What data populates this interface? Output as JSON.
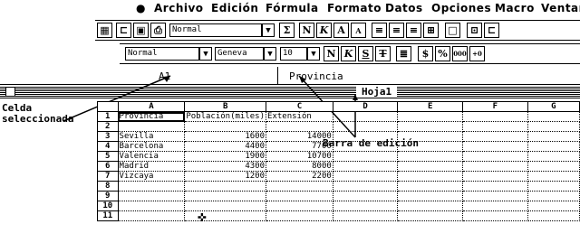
{
  "menu": {
    "apple": "",
    "items": [
      "Archivo",
      "Edición",
      "Fórmula",
      "Formato",
      "Datos",
      "Opciones",
      "Macro",
      "Ventana"
    ]
  },
  "toolbar1": {
    "style_value": "Normal",
    "sum_label": "Σ",
    "bold_label": "N",
    "italic_label": "K",
    "grow_font_label": "A",
    "shrink_font_label": "A"
  },
  "toolbar2": {
    "style_value": "Normal",
    "font_value": "Geneva",
    "size_value": "10",
    "bold_label": "N",
    "italic_label": "K",
    "underline_label": "S",
    "strike_label": "T",
    "percent_label": "%",
    "thousands_label": "000",
    "decimal_label": "+0"
  },
  "formula_bar": {
    "cell_ref": "A1",
    "content": "Provincia"
  },
  "window": {
    "title": "Hoja1"
  },
  "sheet": {
    "columns": [
      "A",
      "B",
      "C",
      "D",
      "E",
      "F",
      "G"
    ],
    "rows": [
      {
        "n": "1",
        "a": "Provincia",
        "b": "Población(miles)",
        "c": "Extensión"
      },
      {
        "n": "2",
        "a": "",
        "b": "",
        "c": ""
      },
      {
        "n": "3",
        "a": "Sevilla",
        "b": "1600",
        "c": "14000"
      },
      {
        "n": "4",
        "a": "Barcelona",
        "b": "4400",
        "c": "7700"
      },
      {
        "n": "5",
        "a": "Valencia",
        "b": "1900",
        "c": "10700"
      },
      {
        "n": "6",
        "a": "Madrid",
        "b": "4300",
        "c": "8000"
      },
      {
        "n": "7",
        "a": "Vizcaya",
        "b": "1200",
        "c": "2200"
      },
      {
        "n": "8",
        "a": "",
        "b": "",
        "c": ""
      },
      {
        "n": "9",
        "a": "",
        "b": "",
        "c": ""
      },
      {
        "n": "10",
        "a": "",
        "b": "",
        "c": ""
      },
      {
        "n": "11",
        "a": "",
        "b": "",
        "c": ""
      }
    ]
  },
  "annotations": {
    "selected_cell_line1": "Celda",
    "selected_cell_line2": "seleccionada",
    "edit_bar": "Barra de edición"
  }
}
